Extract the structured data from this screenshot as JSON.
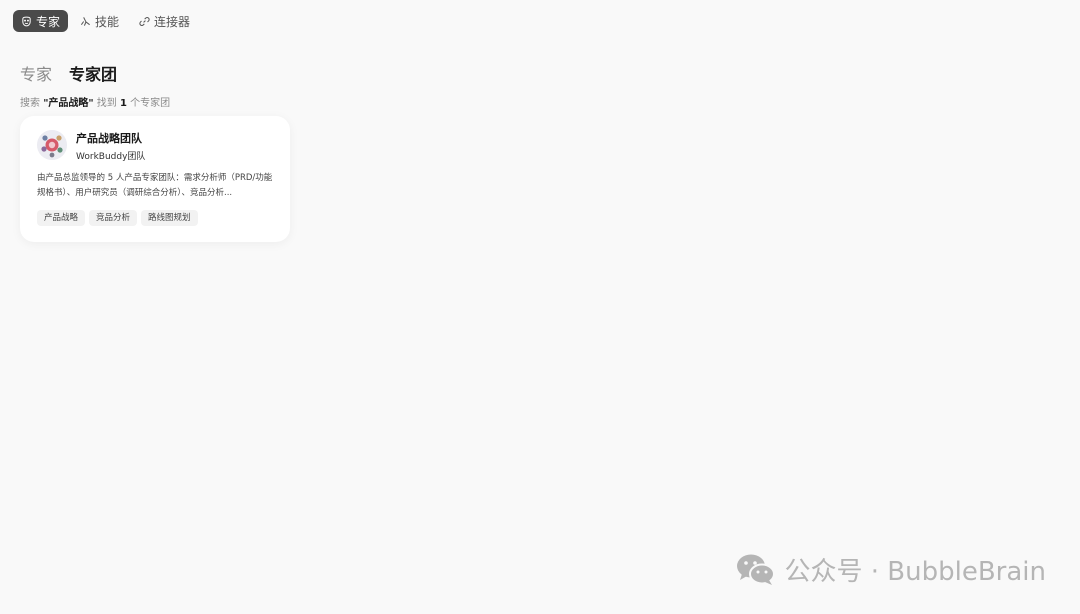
{
  "top_tabs": [
    {
      "label": "专家",
      "icon": "expert-icon",
      "active": true
    },
    {
      "label": "技能",
      "icon": "skill-icon",
      "active": false
    },
    {
      "label": "连接器",
      "icon": "link-icon",
      "active": false
    }
  ],
  "section_tabs": [
    {
      "label": "专家",
      "active": false
    },
    {
      "label": "专家团",
      "active": true
    }
  ],
  "search_summary": {
    "prefix": "搜索",
    "query": "\"产品战略\"",
    "found": "找到",
    "count": "1",
    "suffix": "个专家团"
  },
  "card": {
    "title": "产品战略团队",
    "subtitle": "WorkBuddy团队",
    "description": "由产品总监领导的 5 人产品专家团队：需求分析师（PRD/功能规格书）、用户研究员（调研综合分析）、竞品分析...",
    "tags": [
      "产品战略",
      "竞品分析",
      "路线图规划"
    ]
  },
  "watermark": {
    "text": "公众号 · BubbleBrain",
    "icon": "wechat-icon"
  },
  "colors": {
    "background": "#f9f9f9",
    "active_tab_bg": "#4a4a4a",
    "card_bg": "#ffffff",
    "tag_bg": "#f2f2f2",
    "muted_text": "#8a8a8a"
  }
}
